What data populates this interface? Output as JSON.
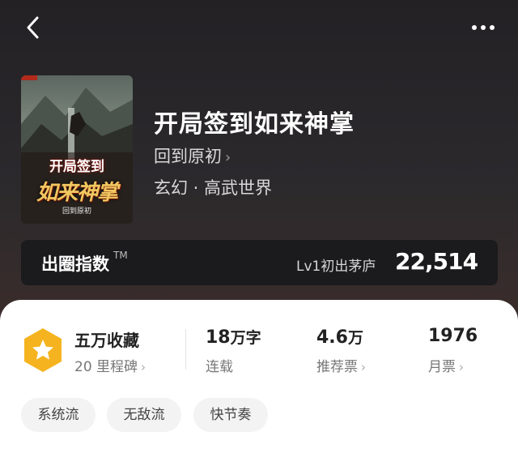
{
  "nav": {
    "back_icon": "chevron-left-icon",
    "more_icon": "more-dots-icon"
  },
  "cover": {
    "title_line1": "开局签到",
    "title_line2": "如来神掌",
    "author": "回到原初"
  },
  "book": {
    "title": "开局签到如来神掌",
    "author": "回到原初",
    "genre": "玄幻 · 高武世界"
  },
  "index": {
    "label": "出圈指数",
    "tm": "TM",
    "level": "Lv1初出茅庐",
    "value": "22,514"
  },
  "stats": {
    "collect_main": "五万收藏",
    "collect_sub": "20 里程碑",
    "words_num": "18",
    "words_unit": "万字",
    "words_sub": "连载",
    "rec_num": "4.6",
    "rec_unit": "万",
    "rec_sub": "推荐票",
    "month_num": "1976",
    "month_sub": "月票"
  },
  "tags": [
    "系统流",
    "无敌流",
    "快节奏"
  ],
  "colors": {
    "badge": "#f5b31f",
    "accent_dark": "#1b1a1c"
  }
}
